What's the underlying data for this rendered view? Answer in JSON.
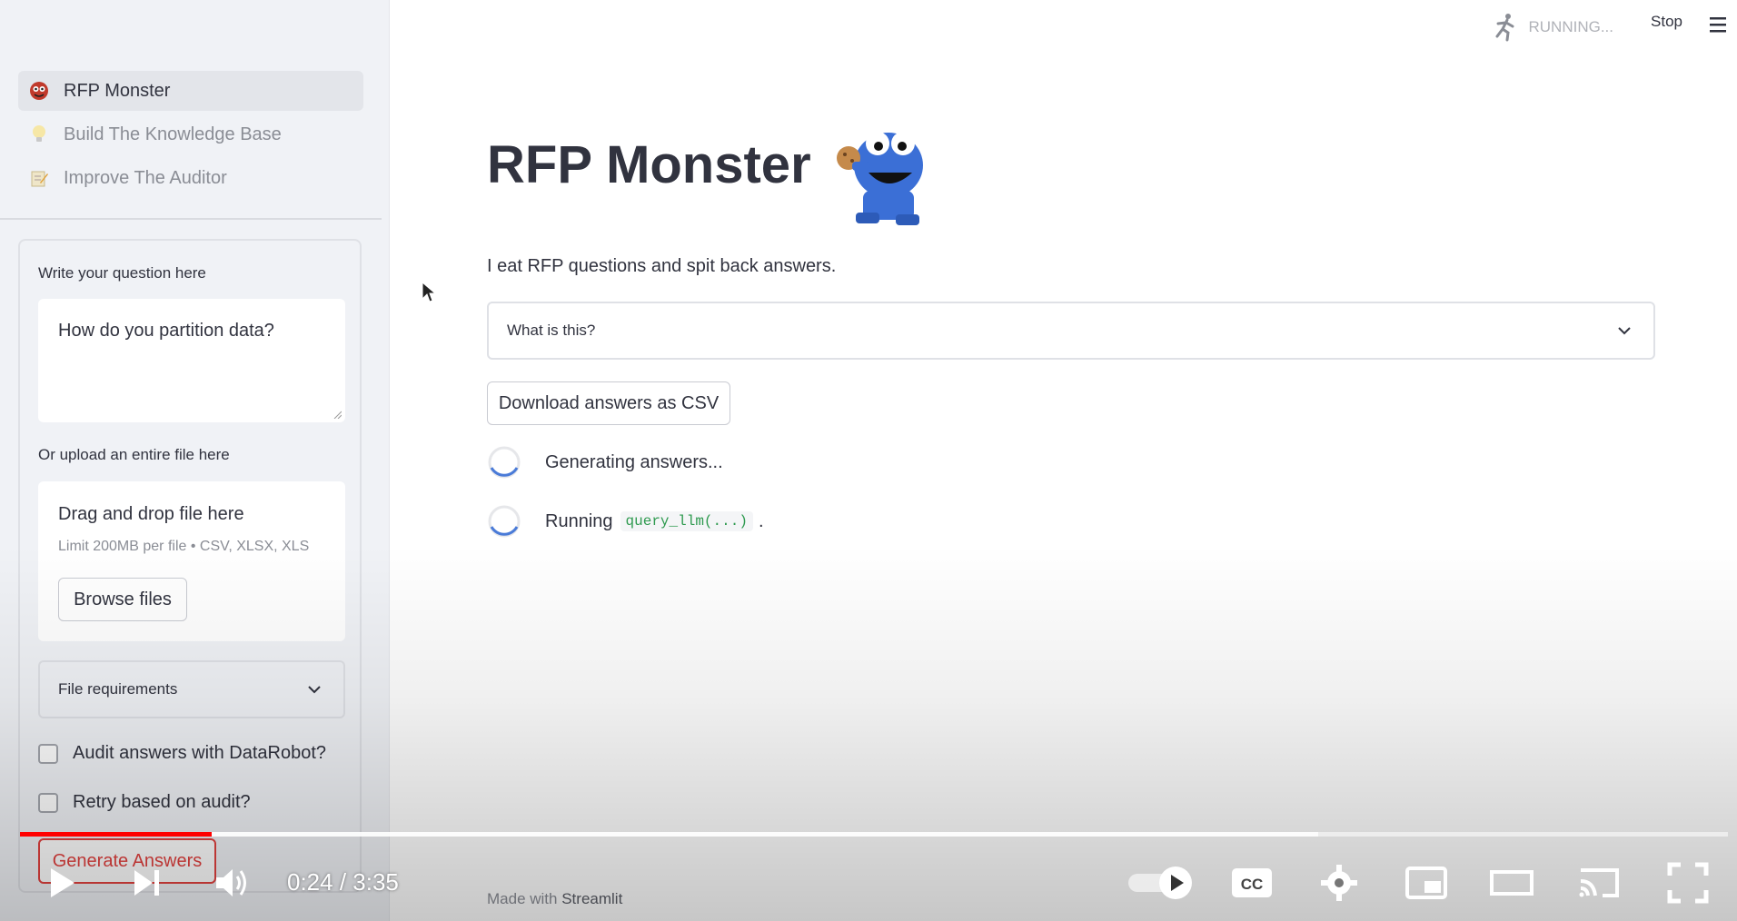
{
  "sidebar": {
    "nav": [
      {
        "label": "RFP Monster",
        "icon": "monster-face-icon",
        "active": true
      },
      {
        "label": "Build The Knowledge Base",
        "icon": "light-bulb-icon",
        "active": false
      },
      {
        "label": "Improve The Auditor",
        "icon": "memo-pencil-icon",
        "active": false
      }
    ],
    "question_label": "Write your question here",
    "question_value": "How do you partition data?",
    "upload_label": "Or upload an entire file here",
    "dropzone_title": "Drag and drop file here",
    "dropzone_limit": "Limit 200MB per file • CSV, XLSX, XLS",
    "browse_label": "Browse files",
    "file_requirements_label": "File requirements",
    "audit_label": "Audit answers with DataRobot?",
    "retry_label": "Retry based on audit?",
    "generate_label": "Generate Answers"
  },
  "header": {
    "status": "RUNNING...",
    "stop": "Stop"
  },
  "main": {
    "title": "RFP Monster",
    "subtitle": "I eat RFP questions and spit back answers.",
    "expander_label": "What is this?",
    "download_label": "Download answers as CSV",
    "spinner1": "Generating answers...",
    "spinner2_prefix": "Running",
    "spinner2_code": "query_llm(...)",
    "spinner2_suffix": ".",
    "footer_prefix": "Made with",
    "footer_brand": "Streamlit"
  },
  "player": {
    "time": "0:24 / 3:35",
    "progress_fraction": 0.112,
    "buffered_fraction": 0.76,
    "colors": {
      "played": "#ff0000",
      "text": "#ffffff"
    }
  }
}
